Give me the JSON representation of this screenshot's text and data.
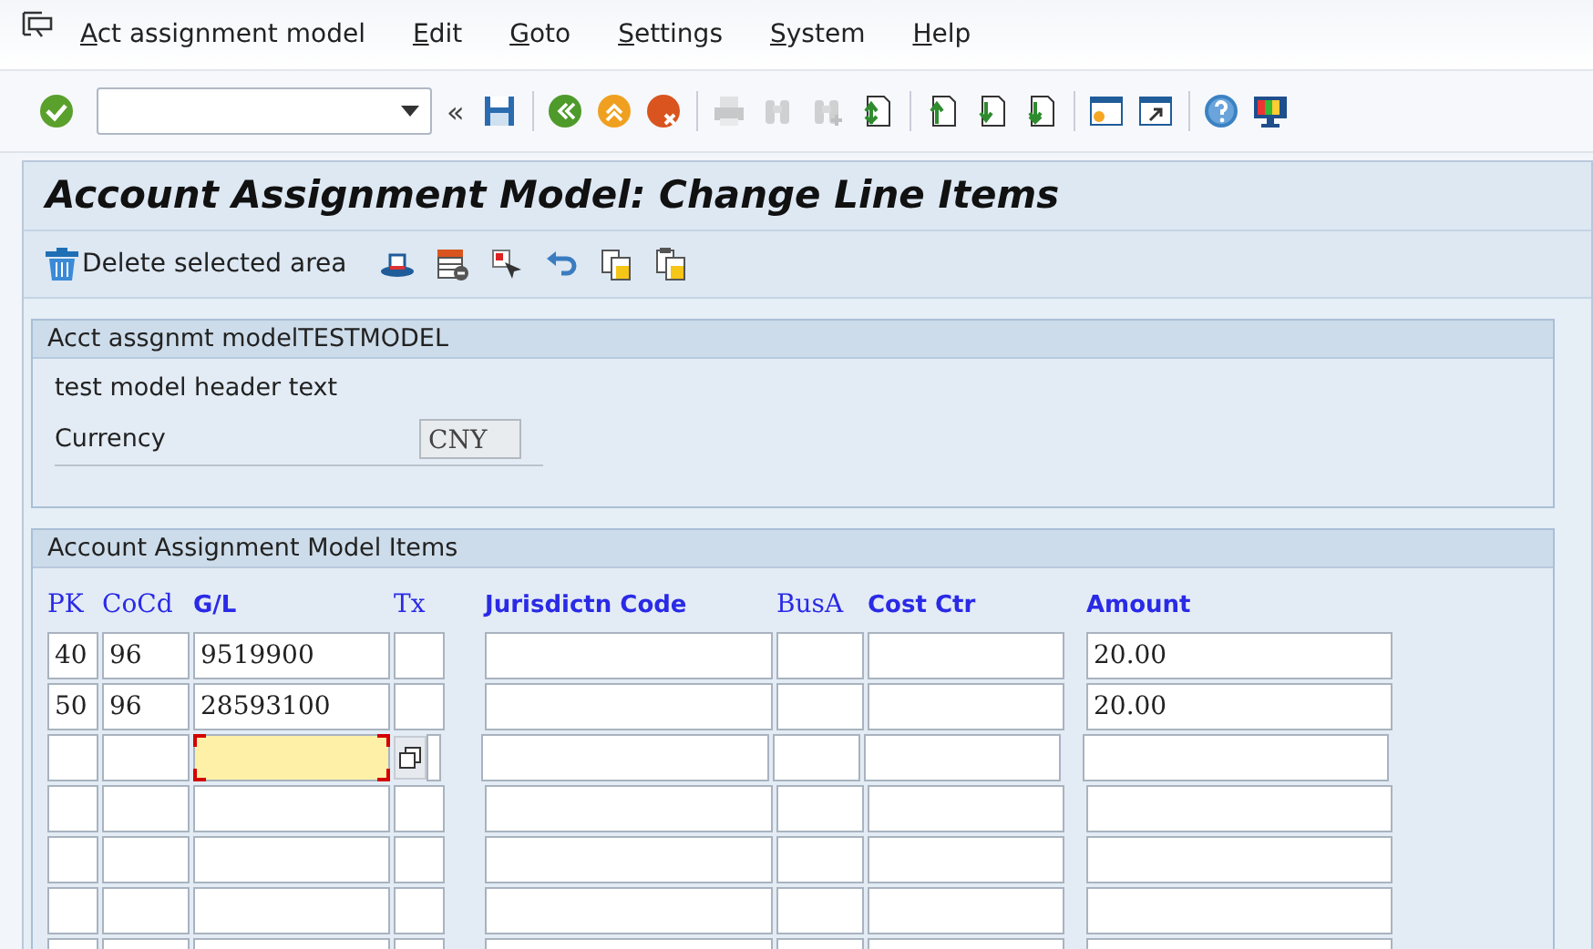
{
  "menu": [
    {
      "label": "Act assignment model"
    },
    {
      "label": "Edit"
    },
    {
      "label": "Goto"
    },
    {
      "label": "Settings"
    },
    {
      "label": "System"
    },
    {
      "label": "Help"
    }
  ],
  "toolbar": {
    "collapse_glyph": "«",
    "buttons": [
      {
        "kind": "enter",
        "disabled": false
      },
      {
        "kind": "save",
        "disabled": false
      },
      {
        "kind": "back",
        "disabled": false
      },
      {
        "kind": "exit",
        "disabled": false
      },
      {
        "kind": "cancel",
        "disabled": false
      },
      {
        "kind": "print",
        "disabled": true
      },
      {
        "kind": "find",
        "disabled": true
      },
      {
        "kind": "find-next",
        "disabled": true
      },
      {
        "kind": "first-page",
        "disabled": false
      },
      {
        "kind": "prev-page",
        "disabled": false
      },
      {
        "kind": "next-page",
        "disabled": false
      },
      {
        "kind": "last-page",
        "disabled": false
      },
      {
        "kind": "new-session",
        "disabled": false
      },
      {
        "kind": "shortcut",
        "disabled": false
      },
      {
        "kind": "help",
        "disabled": false
      },
      {
        "kind": "layout",
        "disabled": false
      }
    ]
  },
  "title": "Account Assignment Model: Change Line Items",
  "app_toolbar": {
    "delete_button": "Delete selected area",
    "icons": [
      {
        "kind": "hat"
      },
      {
        "kind": "delete-row"
      },
      {
        "kind": "select"
      },
      {
        "kind": "undo"
      },
      {
        "kind": "copy"
      },
      {
        "kind": "paste"
      }
    ]
  },
  "header_group": {
    "title": "Acct assgnmt modelTESTMODEL",
    "text": "test model header text",
    "currency_label": "Currency",
    "currency_value": "CNY"
  },
  "items_group": {
    "title": "Account Assignment Model Items",
    "columns": [
      {
        "label": "PK",
        "kind": "serif"
      },
      {
        "label": "CoCd",
        "kind": "serif"
      },
      {
        "label": "G/L",
        "kind": "sans"
      },
      {
        "label": "Tx",
        "kind": "serif"
      },
      {
        "label": "Jurisdictn Code",
        "kind": "sans"
      },
      {
        "label": "BusA",
        "kind": "serif"
      },
      {
        "label": "Cost Ctr",
        "kind": "sans"
      },
      {
        "label": "Amount",
        "kind": "sans"
      }
    ],
    "rows": [
      {
        "cells": [
          {
            "value": "40",
            "focused": false
          },
          {
            "value": "96",
            "focused": false
          },
          {
            "value": "9519900",
            "focused": false
          },
          {
            "focused": false
          },
          {
            "focused": false
          },
          {
            "focused": false
          },
          {
            "focused": false
          },
          {
            "value": "20.00",
            "focused": false
          }
        ]
      },
      {
        "cells": [
          {
            "value": "50",
            "focused": false
          },
          {
            "value": "96",
            "focused": false
          },
          {
            "value": "28593100",
            "focused": false
          },
          {
            "focused": false
          },
          {
            "focused": false
          },
          {
            "focused": false
          },
          {
            "focused": false
          },
          {
            "value": "20.00",
            "focused": false
          }
        ]
      },
      {
        "cells": [
          {
            "focused": false
          },
          {
            "focused": false
          },
          {
            "focused": true
          },
          {
            "focused": false
          },
          {
            "focused": false
          },
          {
            "focused": false
          },
          {
            "focused": false
          },
          {
            "focused": false
          }
        ]
      },
      {
        "cells": [
          {
            "focused": false
          },
          {
            "focused": false
          },
          {
            "focused": false
          },
          {
            "focused": false
          },
          {
            "focused": false
          },
          {
            "focused": false
          },
          {
            "focused": false
          },
          {
            "focused": false
          }
        ]
      },
      {
        "cells": [
          {
            "focused": false
          },
          {
            "focused": false
          },
          {
            "focused": false
          },
          {
            "focused": false
          },
          {
            "focused": false
          },
          {
            "focused": false
          },
          {
            "focused": false
          },
          {
            "focused": false
          }
        ]
      },
      {
        "cells": [
          {
            "focused": false
          },
          {
            "focused": false
          },
          {
            "focused": false
          },
          {
            "focused": false
          },
          {
            "focused": false
          },
          {
            "focused": false
          },
          {
            "focused": false
          },
          {
            "focused": false
          }
        ]
      },
      {
        "cells": [
          {
            "focused": false
          },
          {
            "focused": false
          },
          {
            "focused": false
          },
          {
            "focused": false
          },
          {
            "focused": false
          },
          {
            "focused": false
          },
          {
            "focused": false
          },
          {
            "focused": false
          }
        ]
      }
    ]
  }
}
